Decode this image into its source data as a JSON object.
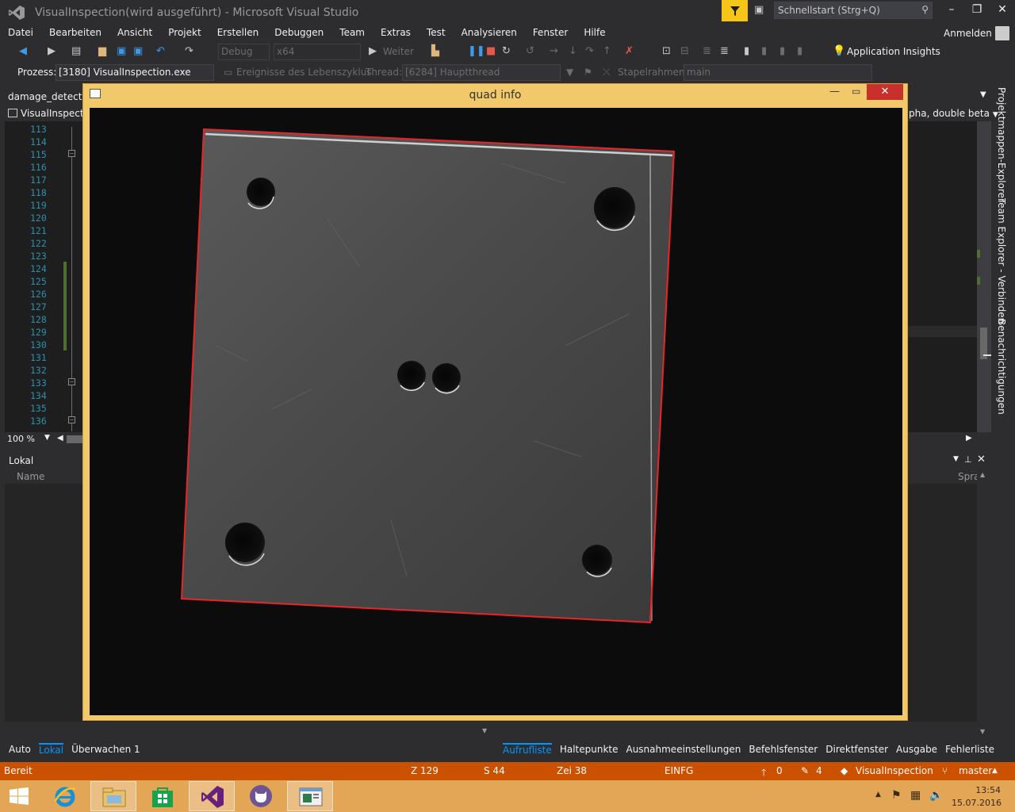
{
  "window": {
    "title": "VisualInspection(wird ausgeführt) - Microsoft Visual Studio",
    "quick_launch_placeholder": "Schnellstart (Strg+Q)"
  },
  "menu": {
    "items": [
      "Datei",
      "Bearbeiten",
      "Ansicht",
      "Projekt",
      "Erstellen",
      "Debuggen",
      "Team",
      "Extras",
      "Test",
      "Analysieren",
      "Fenster",
      "Hilfe"
    ],
    "sign_in": "Anmelden"
  },
  "toolbar": {
    "config": "Debug",
    "platform": "x64",
    "continue": "Weiter",
    "app_insights": "Application Insights"
  },
  "debug_location": {
    "process_label": "Prozess:",
    "process_value": "[3180] VisualInspection.exe",
    "lifecycle": "Ereignisse des Lebenszyklus",
    "thread_label": "Thread:",
    "thread_value": "[6284] Hauptthread",
    "stackframe_label": "Stapelrahmen:",
    "stackframe_value": "main"
  },
  "editor": {
    "doc_tab": "damage_detection",
    "nav_left": "VisualInspection",
    "nav_right": "pha, double beta",
    "line_numbers": [
      "113",
      "114",
      "115",
      "116",
      "117",
      "118",
      "119",
      "120",
      "121",
      "122",
      "123",
      "124",
      "125",
      "126",
      "127",
      "128",
      "129",
      "130",
      "131",
      "132",
      "133",
      "134",
      "135",
      "136"
    ],
    "zoom": "100 %"
  },
  "side_tabs": [
    "Projektmappen-Explorer",
    "Team Explorer - Verbinden",
    "Benachrichtigungen"
  ],
  "locals": {
    "title": "Lokal",
    "col_name": "Name",
    "col_lang": "Spra"
  },
  "bottom_tabs_left": [
    "Auto",
    "Lokal",
    "Überwachen 1"
  ],
  "bottom_tabs_right": [
    "Aufrufliste",
    "Haltepunkte",
    "Ausnahmeeinstellungen",
    "Befehlsfenster",
    "Direktfenster",
    "Ausgabe",
    "Fehlerliste"
  ],
  "status": {
    "ready": "Bereit",
    "row": "Z 129",
    "col": "S 44",
    "char": "Zei 38",
    "mode": "EINFG",
    "up_count": "0",
    "edit_count": "4",
    "project": "VisualInspection",
    "branch": "master"
  },
  "quad_window": {
    "title": "quad info"
  },
  "clock": {
    "time": "13:54",
    "date": "15.07.2016"
  },
  "colors": {
    "accent": "#007acc",
    "status_bar": "#ca5100",
    "taskbar": "#e3a656",
    "quad_outline": "#e8262a"
  }
}
